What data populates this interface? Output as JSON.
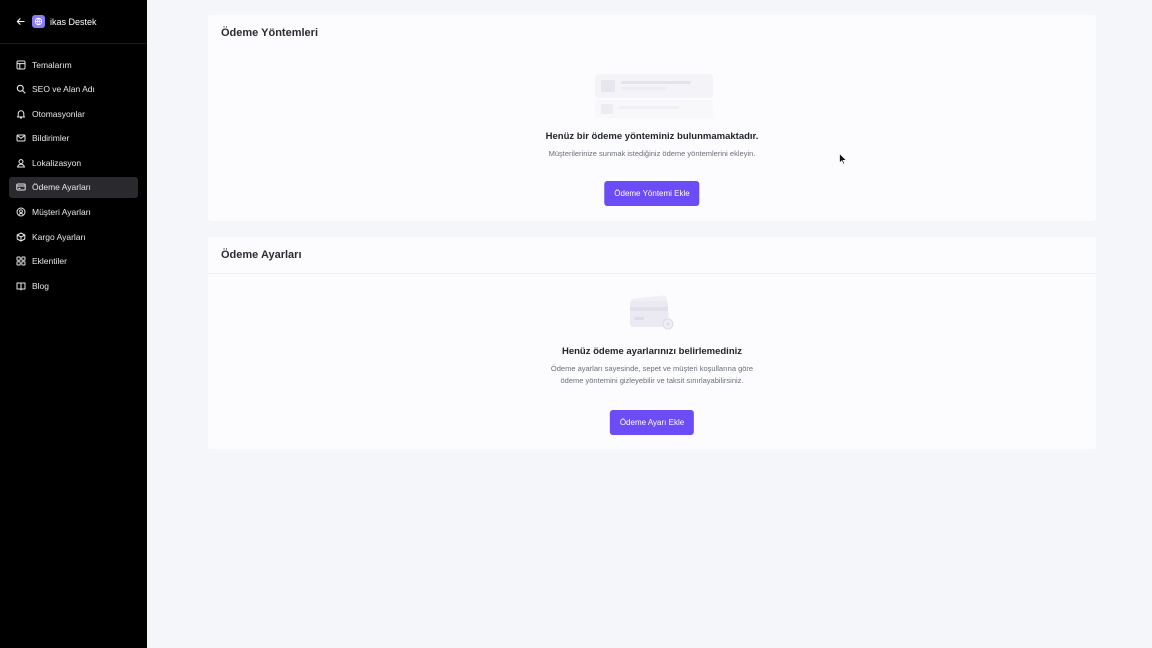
{
  "sidebar": {
    "title": "ikas Destek",
    "items": [
      {
        "label": "Temalarım",
        "icon": "layout-icon",
        "active": false
      },
      {
        "label": "SEO ve Alan Adı",
        "icon": "search-icon",
        "active": false
      },
      {
        "label": "Otomasyonlar",
        "icon": "bell-icon",
        "active": false
      },
      {
        "label": "Bildirimler",
        "icon": "mail-icon",
        "active": false
      },
      {
        "label": "Lokalizasyon",
        "icon": "person-pin-icon",
        "active": false
      },
      {
        "label": "Ödeme Ayarları",
        "icon": "credit-card-icon",
        "active": true
      },
      {
        "label": "Müşteri Ayarları",
        "icon": "user-circle-icon",
        "active": false
      },
      {
        "label": "Kargo Ayarları",
        "icon": "box-icon",
        "active": false
      },
      {
        "label": "Eklentiler",
        "icon": "grid-icon",
        "active": false
      },
      {
        "label": "Blog",
        "icon": "book-icon",
        "active": false
      }
    ]
  },
  "payment_methods": {
    "title": "Ödeme Yöntemleri",
    "empty_title": "Henüz bir ödeme yönteminiz bulunmamaktadır.",
    "empty_desc": "Müşterilerinize sunmak istediğiniz ödeme yöntemlerini ekleyin.",
    "button_label": "Ödeme Yöntemi Ekle"
  },
  "payment_settings": {
    "title": "Ödeme Ayarları",
    "empty_title": "Henüz ödeme ayarlarınızı belirlemediniz",
    "empty_desc_line1": "Ödeme ayarları sayesinde, sepet ve müşteri koşullarına göre",
    "empty_desc_line2": "ödeme yöntemini gizleyebilir ve taksit sınırlayabilirsiniz.",
    "button_label": "Ödeme Ayarı Ekle"
  },
  "colors": {
    "sidebar_bg": "#000000",
    "active_item_bg": "#2a2a2e",
    "primary": "#6c4cf6",
    "page_bg": "#f5f6f9"
  }
}
